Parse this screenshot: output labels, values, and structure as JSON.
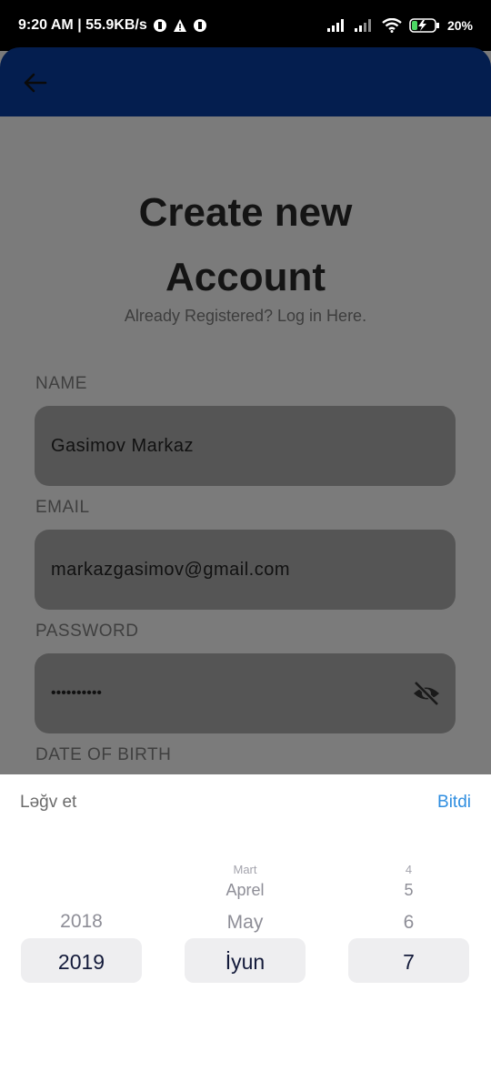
{
  "status_bar": {
    "time_speed": "9:20 AM | 55.9KB/s",
    "battery": "20%"
  },
  "app_bar": {
    "back_icon": "arrow-left-icon"
  },
  "form": {
    "title_line1": "Create new",
    "title_line2": "Account",
    "subtitle": "Already Registered? Log in Here.",
    "name_label": "NAME",
    "name_value": "Gasimov Markaz",
    "email_label": "EMAIL",
    "email_value": "markazgasimov@gmail.com",
    "password_label": "PASSWORD",
    "password_value": "••••••••••",
    "password_toggle_icon": "eye-off-icon",
    "dob_label": "DATE OF BIRTH"
  },
  "date_picker": {
    "cancel_label": "Ləğv et",
    "done_label": "Bitdi",
    "years": [
      "2018",
      "2019"
    ],
    "selected_year": "2019",
    "months": [
      "Mart",
      "Aprel",
      "May",
      "İyun"
    ],
    "selected_month": "İyun",
    "days": [
      "4",
      "5",
      "6",
      "7"
    ],
    "selected_day": "7"
  },
  "colors": {
    "app_bar": "#041e4f",
    "done_link": "#2f8ee0",
    "overlay": "#7b7b7b"
  }
}
